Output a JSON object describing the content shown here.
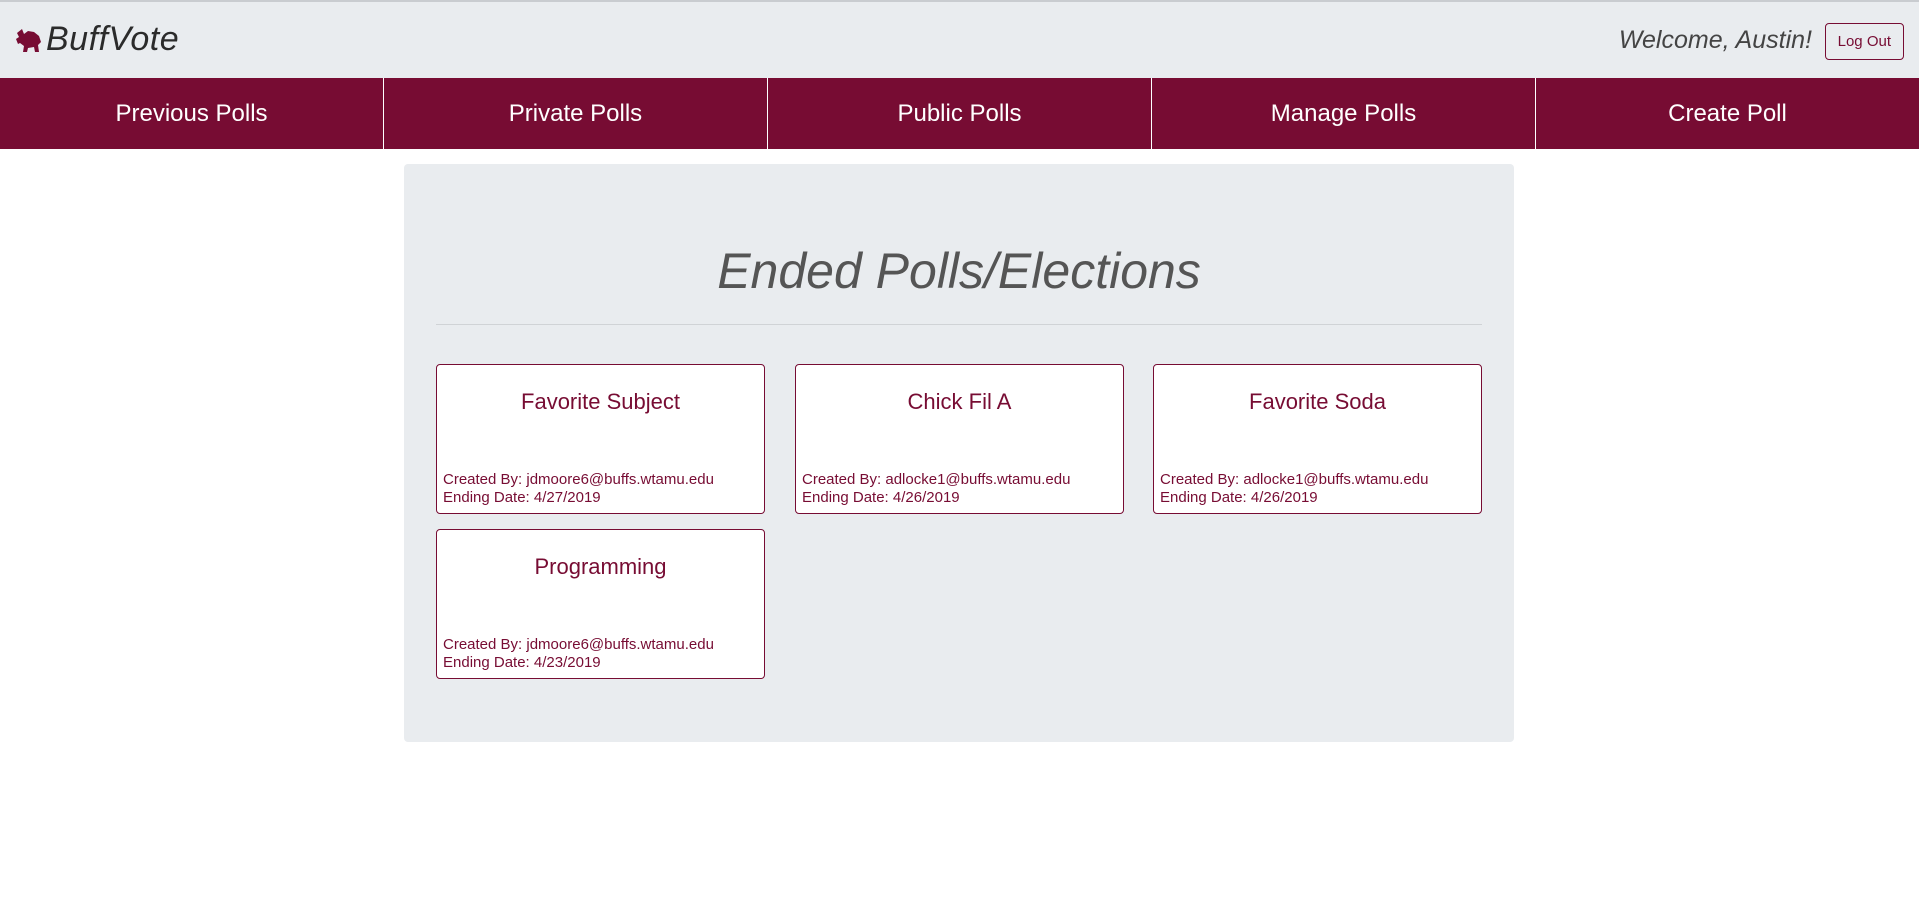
{
  "header": {
    "brand": "BuffVote",
    "welcome": "Welcome, Austin!",
    "logout_label": "Log Out"
  },
  "nav": {
    "items": [
      {
        "label": "Previous Polls"
      },
      {
        "label": "Private Polls"
      },
      {
        "label": "Public Polls"
      },
      {
        "label": "Manage Polls"
      },
      {
        "label": "Create Poll"
      }
    ]
  },
  "main": {
    "title": "Ended Polls/Elections",
    "polls": [
      {
        "title": "Favorite Subject",
        "created_by": "Created By: jdmoore6@buffs.wtamu.edu",
        "ending_date": "Ending Date: 4/27/2019"
      },
      {
        "title": "Chick Fil A",
        "created_by": "Created By: adlocke1@buffs.wtamu.edu",
        "ending_date": "Ending Date: 4/26/2019"
      },
      {
        "title": "Favorite Soda",
        "created_by": "Created By: adlocke1@buffs.wtamu.edu",
        "ending_date": "Ending Date: 4/26/2019"
      },
      {
        "title": "Programming",
        "created_by": "Created By: jdmoore6@buffs.wtamu.edu",
        "ending_date": "Ending Date: 4/23/2019"
      }
    ]
  },
  "colors": {
    "brand_maroon": "#770c33",
    "header_bg": "#e9ecef"
  },
  "icons": {
    "brand_logo": "buffalo-logo-icon"
  }
}
